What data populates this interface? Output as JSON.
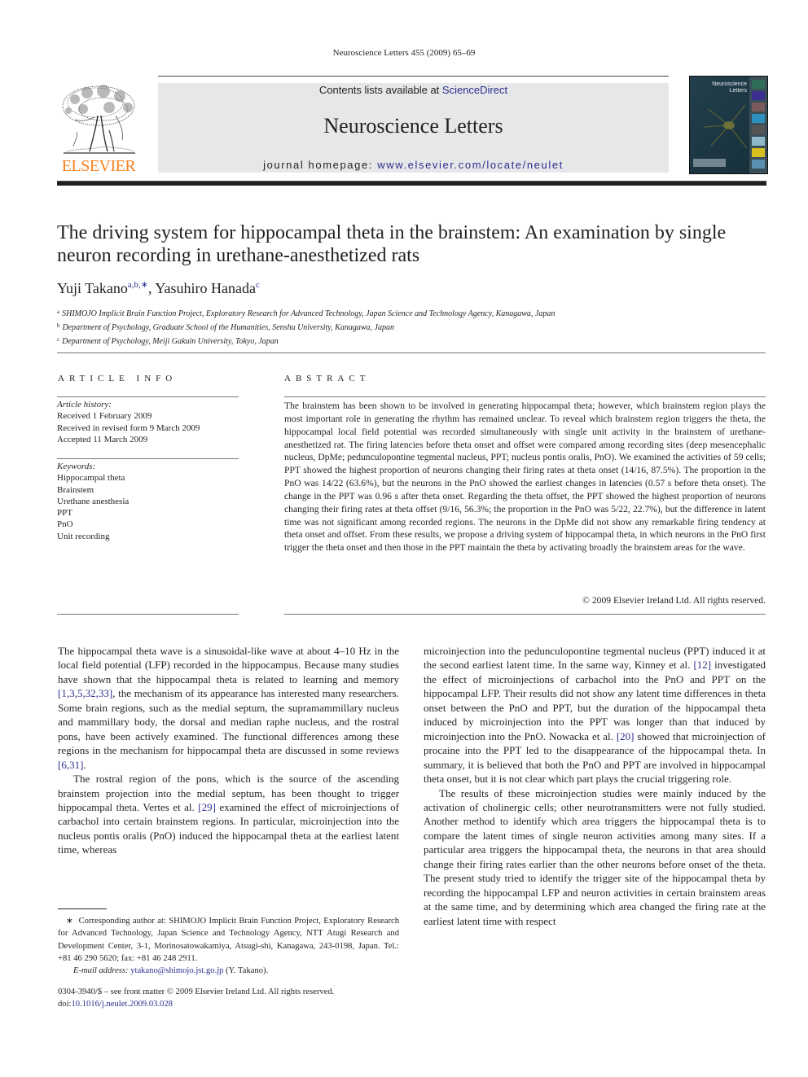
{
  "running_head": "Neuroscience Letters 455 (2009) 65–69",
  "masthead": {
    "publisher_logo_text": "ELSEVIER",
    "contents_prefix": "Contents lists available at ",
    "contents_link": "ScienceDirect",
    "journal_name": "Neuroscience Letters",
    "homepage_prefix": "journal homepage: ",
    "homepage_url": "www.elsevier.com/locate/neulet",
    "cover_title_line1": "Neuroscience",
    "cover_title_line2": "Letters",
    "colors": {
      "brand_orange": "#f58220",
      "link_blue": "#2b2f8f",
      "band_gray": "#e6e7e8"
    }
  },
  "article": {
    "title": "The driving system for hippocampal theta in the brainstem: An examination by single neuron recording in urethane-anesthetized rats",
    "authors": [
      {
        "name": "Yuji Takano",
        "marks": "a,b,∗"
      },
      {
        "name": "Yasuhiro Hanada",
        "marks": "c"
      }
    ],
    "author_separator": ", ",
    "affiliations": [
      {
        "mark": "a",
        "text": "SHIMOJO Implicit Brain Function Project, Exploratory Research for Advanced Technology, Japan Science and Technology Agency, Kanagawa, Japan"
      },
      {
        "mark": "b",
        "text": "Department of Psychology, Graduate School of the Humanities, Senshu University, Kanagawa, Japan"
      },
      {
        "mark": "c",
        "text": "Department of Psychology, Meiji Gakuin University, Tokyo, Japan"
      }
    ]
  },
  "article_info": {
    "heading": "ARTICLE INFO",
    "history_label": "Article history:",
    "history": [
      "Received 1 February 2009",
      "Received in revised form 9 March 2009",
      "Accepted 11 March 2009"
    ],
    "keywords_label": "Keywords:",
    "keywords": [
      "Hippocampal theta",
      "Brainstem",
      "Urethane anesthesia",
      "PPT",
      "PnO",
      "Unit recording"
    ]
  },
  "abstract": {
    "heading": "ABSTRACT",
    "text": "The brainstem has been shown to be involved in generating hippocampal theta; however, which brainstem region plays the most important role in generating the rhythm has remained unclear. To reveal which brainstem region triggers the theta, the hippocampal local field potential was recorded simultaneously with single unit activity in the brainstem of urethane-anesthetized rat. The firing latencies before theta onset and offset were compared among recording sites (deep mesencephalic nucleus, DpMe; pedunculopontine tegmental nucleus, PPT; nucleus pontis oralis, PnO). We examined the activities of 59 cells; PPT showed the highest proportion of neurons changing their firing rates at theta onset (14/16, 87.5%). The proportion in the PnO was 14/22 (63.6%), but the neurons in the PnO showed the earliest changes in latencies (0.57 s before theta onset). The change in the PPT was 0.96 s after theta onset. Regarding the theta offset, the PPT showed the highest proportion of neurons changing their firing rates at theta offset (9/16, 56.3%; the proportion in the PnO was 5/22, 22.7%), but the difference in latent time was not significant among recorded regions. The neurons in the DpMe did not show any remarkable firing tendency at theta onset and offset. From these results, we propose a driving system of hippocampal theta, in which neurons in the PnO first trigger the theta onset and then those in the PPT maintain the theta by activating broadly the brainstem areas for the wave.",
    "copyright": "© 2009 Elsevier Ireland Ltd. All rights reserved."
  },
  "body": {
    "left_p1": {
      "before": "The hippocampal theta wave is a sinusoidal-like wave at about 4–10 Hz in the local field potential (LFP) recorded in the hippocampus. Because many studies have shown that the hippocampal theta is related to learning and memory ",
      "ref": "[1,3,5,32,33]",
      "after": ", the mechanism of its appearance has interested many researchers. Some brain regions, such as the medial septum, the supramammillary nucleus and mammillary body, the dorsal and median raphe nucleus, and the rostral pons, have been actively examined. The functional differences among these regions in the mechanism for hippocampal theta are discussed in some reviews ",
      "ref2": "[6,31]",
      "end": "."
    },
    "left_p2": {
      "before": "The rostral region of the pons, which is the source of the ascending brainstem projection into the medial septum, has been thought to trigger hippocampal theta. Vertes et al. ",
      "ref": "[29]",
      "after": " examined the effect of microinjections of carbachol into certain brainstem regions. In particular, microinjection into the nucleus pontis oralis (PnO) induced the hippocampal theta at the earliest latent time, whereas"
    },
    "right_p1": {
      "before": "microinjection into the pedunculopontine tegmental nucleus (PPT) induced it at the second earliest latent time. In the same way, Kinney et al. ",
      "ref": "[12]",
      "mid": " investigated the effect of microinjections of carbachol into the PnO and PPT on the hippocampal LFP. Their results did not show any latent time differences in theta onset between the PnO and PPT, but the duration of the hippocampal theta induced by microinjection into the PPT was longer than that induced by microinjection into the PnO. Nowacka et al. ",
      "ref2": "[20]",
      "after": " showed that microinjection of procaine into the PPT led to the disappearance of the hippocampal theta. In summary, it is believed that both the PnO and PPT are involved in hippocampal theta onset, but it is not clear which part plays the crucial triggering role."
    },
    "right_p2": "The results of these microinjection studies were mainly induced by the activation of cholinergic cells; other neurotransmitters were not fully studied. Another method to identify which area triggers the hippocampal theta is to compare the latent times of single neuron activities among many sites. If a particular area triggers the hippocampal theta, the neurons in that area should change their firing rates earlier than the other neurons before onset of the theta. The present study tried to identify the trigger site of the hippocampal theta by recording the hippocampal LFP and neuron activities in certain brainstem areas at the same time, and by determining which area changed the firing rate at the earliest latent time with respect"
  },
  "footnote": {
    "mark": "∗",
    "corresponding": "Corresponding author at: SHIMOJO Implicit Brain Function Project, Exploratory Research for Advanced Technology, Japan Science and Technology Agency, NTT Atugi Research and Development Center, 3-1, Morinosatowakamiya, Atsugi-shi, Kanagawa, 243-0198, Japan. Tel.: +81 46 290 5620; fax: +81 46 248 2911.",
    "email_label": "E-mail address: ",
    "email": "ytakano@shimojo.jst.go.jp",
    "email_suffix": " (Y. Takano)."
  },
  "front_matter": {
    "issn_line": "0304-3940/$ – see front matter © 2009 Elsevier Ireland Ltd. All rights reserved.",
    "doi_label": "doi:",
    "doi": "10.1016/j.neulet.2009.03.028"
  }
}
